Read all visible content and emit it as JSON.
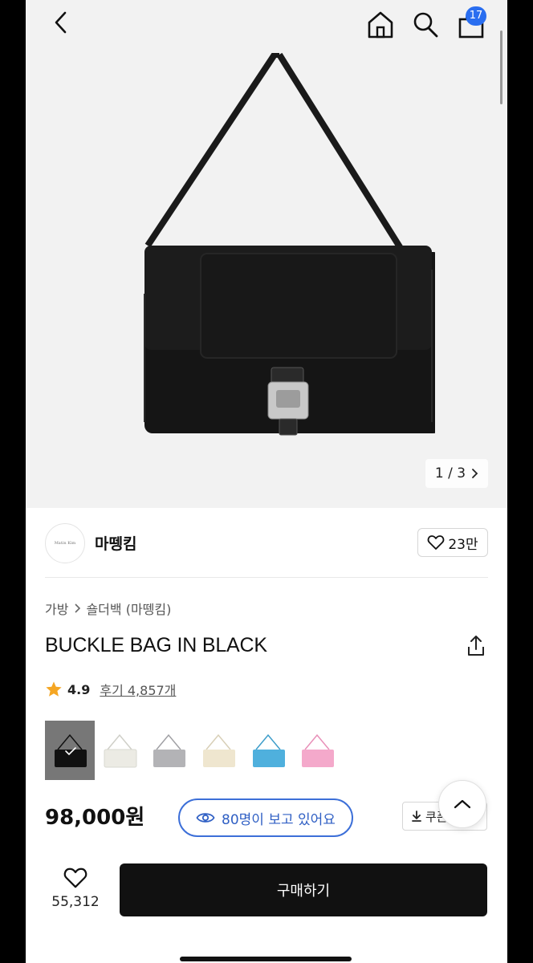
{
  "header": {
    "cart_count": "17"
  },
  "gallery": {
    "pager_text": "1 / 3"
  },
  "brand": {
    "name": "마뗑킴",
    "logo_text": "Matin Kim",
    "likes": "23만"
  },
  "breadcrumb": {
    "category": "가방",
    "subcategory": "숄더백 (마뗑킴)"
  },
  "product": {
    "title": "BUCKLE BAG IN BLACK",
    "rating": "4.9",
    "reviews_label": "후기 4,857개",
    "price": "98,000원",
    "viewers_label": "80명이 보고 있어요",
    "coupon_label": "쿠폰"
  },
  "swatches": [
    {
      "name": "black",
      "color": "#111111",
      "selected": true
    },
    {
      "name": "ivory",
      "color": "#ecebe4"
    },
    {
      "name": "gray",
      "color": "#b3b3b6"
    },
    {
      "name": "cream",
      "color": "#efe6cf"
    },
    {
      "name": "sky-blue",
      "color": "#4fb0dd"
    },
    {
      "name": "pink",
      "color": "#f4a9cb"
    }
  ],
  "actions": {
    "wish_count": "55,312",
    "buy_label": "구매하기"
  },
  "colors": {
    "accent_blue": "#2a6ef0",
    "viewer_blue": "#3c6fd8",
    "buy_button": "#111111",
    "star": "#f5a623"
  }
}
